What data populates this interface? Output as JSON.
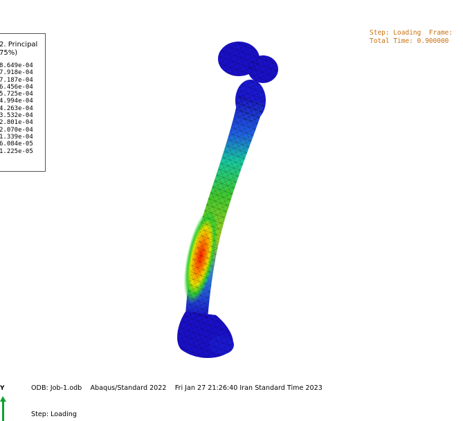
{
  "legend": {
    "title_line1": "2. Principal",
    "title_line2": "75%)",
    "values": [
      "8.649e-04",
      "7.918e-04",
      "7.187e-04",
      "6.456e-04",
      "5.725e-04",
      "4.994e-04",
      "4.263e-04",
      "3.532e-04",
      "2.801e-04",
      "2.070e-04",
      "1.339e-04",
      "6.084e-05",
      "1.225e-05"
    ]
  },
  "step_info": {
    "line1": "Step: Loading  Frame:",
    "line2": "Total Time: 0.900000"
  },
  "footer": {
    "odb_line": "ODB: Job-1.odb    Abaqus/Standard 2022    Fri Jan 27 21:26:40 Iran Standard Time 2023",
    "step_line": "Step: Loading"
  },
  "triad": {
    "axis_label": "Y"
  },
  "colors": {
    "low": "#1a10c8",
    "mid": "#18c8a0",
    "high": "#ff1a00",
    "info_text": "#c87010"
  }
}
